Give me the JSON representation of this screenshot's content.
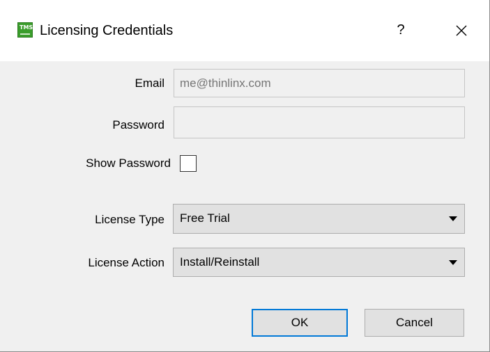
{
  "window": {
    "title": "Licensing Credentials",
    "icon": "tms-app-icon",
    "icon_text": "TMS",
    "help_label": "?",
    "close_icon": "close-icon"
  },
  "form": {
    "email_label": "Email",
    "email_placeholder": "me@thinlinx.com",
    "email_value": "",
    "password_label": "Password",
    "password_value": "",
    "show_password_label": "Show Password",
    "show_password_checked": false,
    "license_type_label": "License Type",
    "license_type_value": "Free Trial",
    "license_action_label": "License Action",
    "license_action_value": "Install/Reinstall"
  },
  "buttons": {
    "ok_label": "OK",
    "cancel_label": "Cancel"
  },
  "colors": {
    "accent": "#0078d7",
    "icon_green": "#3a9d2b"
  }
}
